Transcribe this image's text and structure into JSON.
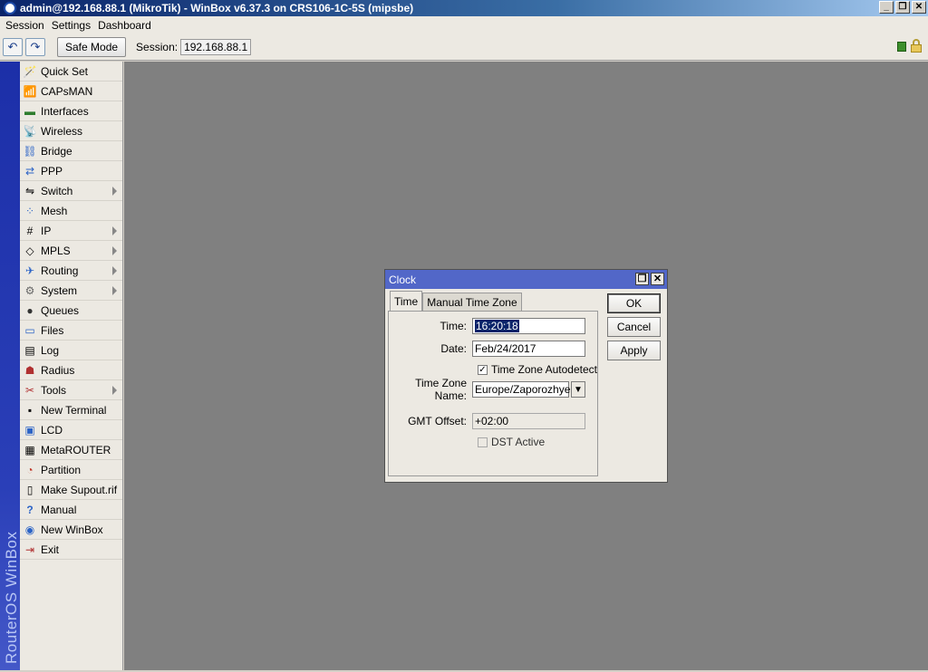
{
  "window": {
    "title": "admin@192.168.88.1 (MikroTik) - WinBox v6.37.3 on CRS106-1C-5S (mipsbe)",
    "minimize": "_",
    "restore": "❐",
    "close": "✕"
  },
  "menu": {
    "items": [
      "Session",
      "Settings",
      "Dashboard"
    ]
  },
  "toolbar": {
    "undo": "↶",
    "redo": "↷",
    "safe_mode": "Safe Mode",
    "session_label": "Session:",
    "session_value": "192.168.88.1"
  },
  "sidebar": {
    "brand": "RouterOS WinBox",
    "items": [
      {
        "label": "Quick Set",
        "icon": "🪄"
      },
      {
        "label": "CAPsMAN",
        "icon": "📶"
      },
      {
        "label": "Interfaces",
        "icon": "▬"
      },
      {
        "label": "Wireless",
        "icon": "📡"
      },
      {
        "label": "Bridge",
        "icon": "⛓"
      },
      {
        "label": "PPP",
        "icon": "⇄"
      },
      {
        "label": "Switch",
        "icon": "⇋"
      },
      {
        "label": "Mesh",
        "icon": "⁘"
      },
      {
        "label": "IP",
        "icon": "#"
      },
      {
        "label": "MPLS",
        "icon": "◇"
      },
      {
        "label": "Routing",
        "icon": "✈"
      },
      {
        "label": "System",
        "icon": "⚙"
      },
      {
        "label": "Queues",
        "icon": "●"
      },
      {
        "label": "Files",
        "icon": "▭"
      },
      {
        "label": "Log",
        "icon": "▤"
      },
      {
        "label": "Radius",
        "icon": "☗"
      },
      {
        "label": "Tools",
        "icon": "✂"
      },
      {
        "label": "New Terminal",
        "icon": "▪"
      },
      {
        "label": "LCD",
        "icon": "▣"
      },
      {
        "label": "MetaROUTER",
        "icon": "▦"
      },
      {
        "label": "Partition",
        "icon": "◔"
      },
      {
        "label": "Make Supout.rif",
        "icon": "▯"
      },
      {
        "label": "Manual",
        "icon": "?"
      },
      {
        "label": "New WinBox",
        "icon": "◉"
      },
      {
        "label": "Exit",
        "icon": "⇥"
      }
    ]
  },
  "clock": {
    "title": "Clock",
    "tabs": [
      "Time",
      "Manual Time Zone"
    ],
    "time_label": "Time:",
    "time_value": "16:20:18",
    "date_label": "Date:",
    "date_value": "Feb/24/2017",
    "autodetect_label": "Time Zone Autodetect",
    "autodetect_mark": "✓",
    "tz_label": "Time Zone Name:",
    "tz_value": "Europe/Zaporozhye",
    "tz_arrow": "▼",
    "gmt_label": "GMT Offset:",
    "gmt_value": "+02:00",
    "dst_label": "DST Active",
    "ok": "OK",
    "cancel": "Cancel",
    "apply": "Apply",
    "restore": "❐",
    "close": "✕"
  }
}
